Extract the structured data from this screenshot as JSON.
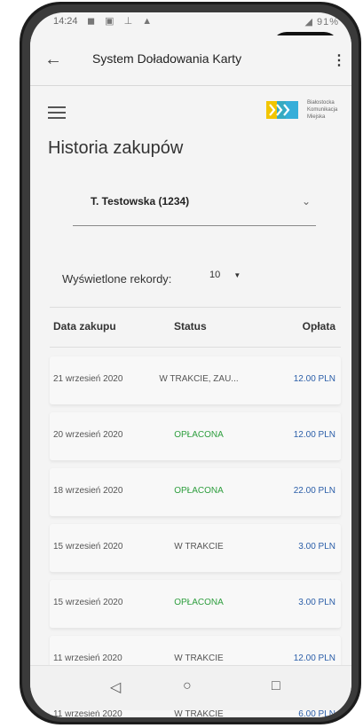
{
  "status_bar": {
    "time": "14:24",
    "battery": "91%"
  },
  "app_bar": {
    "back_icon": "arrow-left-icon",
    "title": "System Doładowania Karty",
    "overflow_icon": "more-vert-icon"
  },
  "page": {
    "menu_icon": "hamburger-icon",
    "logo": {
      "lines": [
        "Białostocka",
        "Komunikacja",
        "Miejska"
      ],
      "colors": [
        "#f2c500",
        "#21a6d6"
      ]
    },
    "title": "Historia zakupów",
    "card_select": {
      "value": "T. Testowska (1234)",
      "icon": "chevron-down-icon"
    },
    "records": {
      "label": "Wyświetlone rekordy:",
      "value": "10"
    }
  },
  "table": {
    "headers": [
      "Data zakupu",
      "Status",
      "Opłata"
    ],
    "rows": [
      {
        "date": "21 wrzesień 2020",
        "status": "W TRAKCIE, ZAU...",
        "fee": "12.00 PLN",
        "paid": false
      },
      {
        "date": "20 wrzesień 2020",
        "status": "OPŁACONA",
        "fee": "12.00 PLN",
        "paid": true
      },
      {
        "date": "18 wrzesień 2020",
        "status": "OPŁACONA",
        "fee": "22.00 PLN",
        "paid": true
      },
      {
        "date": "15 wrzesień 2020",
        "status": "W TRAKCIE",
        "fee": "3.00 PLN",
        "paid": false
      },
      {
        "date": "15 wrzesień 2020",
        "status": "OPŁACONA",
        "fee": "3.00 PLN",
        "paid": true
      },
      {
        "date": "11 wrzesień 2020",
        "status": "W TRAKCIE",
        "fee": "12.00 PLN",
        "paid": false
      },
      {
        "date": "11 wrzesień 2020",
        "status": "W TRAKCIE",
        "fee": "6.00 PLN",
        "paid": false
      }
    ]
  },
  "colors": {
    "paid": "#2e9e3e",
    "fee": "#2b5ea8",
    "pending": "#555555"
  },
  "nav": {
    "back": "◁",
    "home": "○",
    "recents": "□"
  }
}
